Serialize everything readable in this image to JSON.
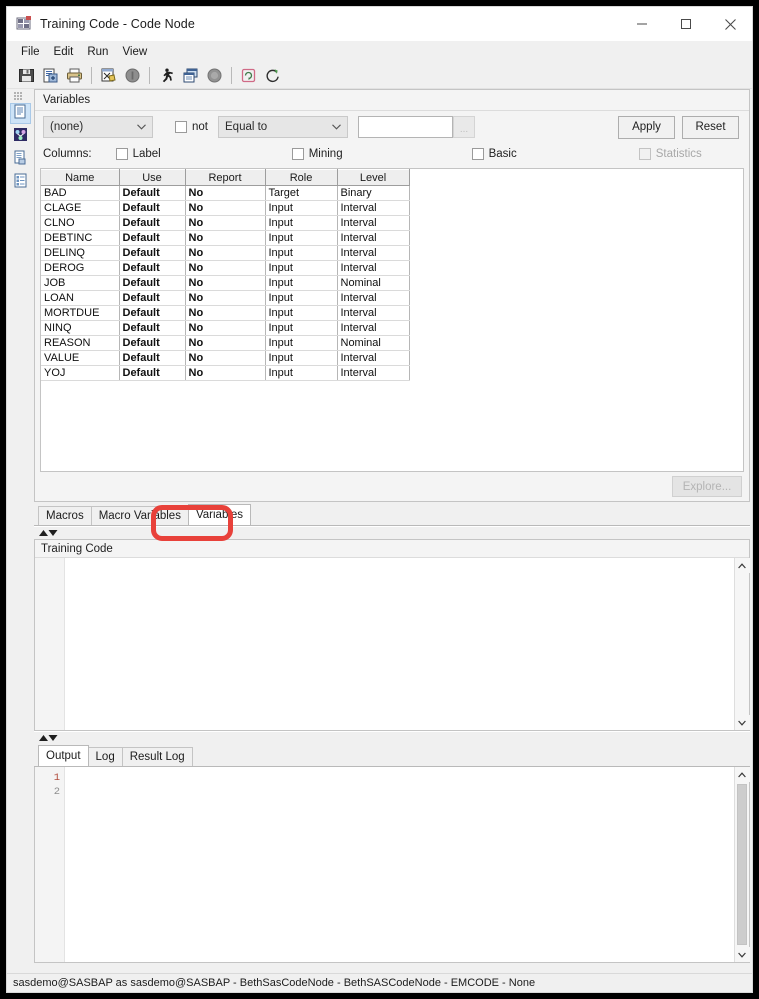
{
  "window": {
    "title": "Training Code - Code Node",
    "app_icon": "sas-node-icon",
    "controls": [
      {
        "name": "minimize-button",
        "glyph": "minimize-icon"
      },
      {
        "name": "maximize-button",
        "glyph": "maximize-icon"
      },
      {
        "name": "close-button",
        "glyph": "close-icon"
      }
    ]
  },
  "menubar": {
    "items": [
      {
        "label": "File"
      },
      {
        "label": "Edit"
      },
      {
        "label": "Run"
      },
      {
        "label": "View"
      }
    ]
  },
  "toolbar": {
    "buttons": [
      {
        "name": "save-button",
        "icon": "floppy-disk-icon"
      },
      {
        "name": "save-as-button",
        "icon": "document-copy-icon"
      },
      {
        "name": "print-button",
        "icon": "printer-icon"
      },
      {
        "name": "edit-code-button",
        "icon": "code-window-icon"
      },
      {
        "name": "stop-button",
        "icon": "stop-circle-icon"
      },
      {
        "name": "run-button",
        "icon": "running-man-icon"
      },
      {
        "name": "run-window-button",
        "icon": "cascade-windows-icon"
      },
      {
        "name": "interrupt-button",
        "icon": "gray-circle-icon"
      },
      {
        "name": "reset-button",
        "icon": "refresh-pink-icon"
      },
      {
        "name": "reload-button",
        "icon": "reload-green-icon"
      }
    ]
  },
  "rail": {
    "items": [
      {
        "name": "sidebar-item-properties",
        "icon": "document-page-icon",
        "selected": true
      },
      {
        "name": "sidebar-item-diagram",
        "icon": "flow-diagram-icon",
        "selected": false
      },
      {
        "name": "sidebar-item-code",
        "icon": "code-page-icon",
        "selected": false
      },
      {
        "name": "sidebar-item-results",
        "icon": "list-report-icon",
        "selected": false
      }
    ]
  },
  "variables_panel": {
    "caption": "Variables",
    "filter": {
      "column_select_value": "(none)",
      "not_label": "not",
      "not_checked": false,
      "operator_value": "Equal to",
      "value_input": "",
      "value_placeholder": "",
      "browse_label": "...",
      "apply_label": "Apply",
      "reset_label": "Reset"
    },
    "columns_row": {
      "label": "Columns:",
      "checks": [
        {
          "label": "Label",
          "checked": false,
          "disabled": false
        },
        {
          "label": "Mining",
          "checked": false,
          "disabled": false
        },
        {
          "label": "Basic",
          "checked": false,
          "disabled": false
        },
        {
          "label": "Statistics",
          "checked": false,
          "disabled": true
        }
      ]
    },
    "grid": {
      "headers": [
        "Name",
        "Use",
        "Report",
        "Role",
        "Level"
      ],
      "rows": [
        [
          "BAD",
          "Default",
          "No",
          "Target",
          "Binary"
        ],
        [
          "CLAGE",
          "Default",
          "No",
          "Input",
          "Interval"
        ],
        [
          "CLNO",
          "Default",
          "No",
          "Input",
          "Interval"
        ],
        [
          "DEBTINC",
          "Default",
          "No",
          "Input",
          "Interval"
        ],
        [
          "DELINQ",
          "Default",
          "No",
          "Input",
          "Interval"
        ],
        [
          "DEROG",
          "Default",
          "No",
          "Input",
          "Interval"
        ],
        [
          "JOB",
          "Default",
          "No",
          "Input",
          "Nominal"
        ],
        [
          "LOAN",
          "Default",
          "No",
          "Input",
          "Interval"
        ],
        [
          "MORTDUE",
          "Default",
          "No",
          "Input",
          "Interval"
        ],
        [
          "NINQ",
          "Default",
          "No",
          "Input",
          "Interval"
        ],
        [
          "REASON",
          "Default",
          "No",
          "Input",
          "Nominal"
        ],
        [
          "VALUE",
          "Default",
          "No",
          "Input",
          "Interval"
        ],
        [
          "YOJ",
          "Default",
          "No",
          "Input",
          "Interval"
        ]
      ]
    },
    "explore_label": "Explore..."
  },
  "variable_tabs": {
    "items": [
      {
        "label": "Macros",
        "active": false
      },
      {
        "label": "Macro Variables",
        "active": false
      },
      {
        "label": "Variables",
        "active": true
      }
    ],
    "highlighted_tab": "Variables"
  },
  "code_panel": {
    "caption": "Training Code",
    "content": "",
    "line_numbers": []
  },
  "output_panel": {
    "tabs": [
      {
        "label": "Output",
        "active": true
      },
      {
        "label": "Log",
        "active": false
      },
      {
        "label": "Result Log",
        "active": false
      }
    ],
    "line_numbers": [
      "1",
      "2"
    ],
    "content": ""
  },
  "statusbar": {
    "text": "sasdemo@SASBAP as sasdemo@SASBAP  - BethSasCodeNode -  BethSASCodeNode - EMCODE - None"
  },
  "colors": {
    "annotation": "#e8413a",
    "selected_rail": "#cde3f7",
    "window_bg": "#f0f0f0",
    "panel_bg": "#f4f4f4"
  }
}
